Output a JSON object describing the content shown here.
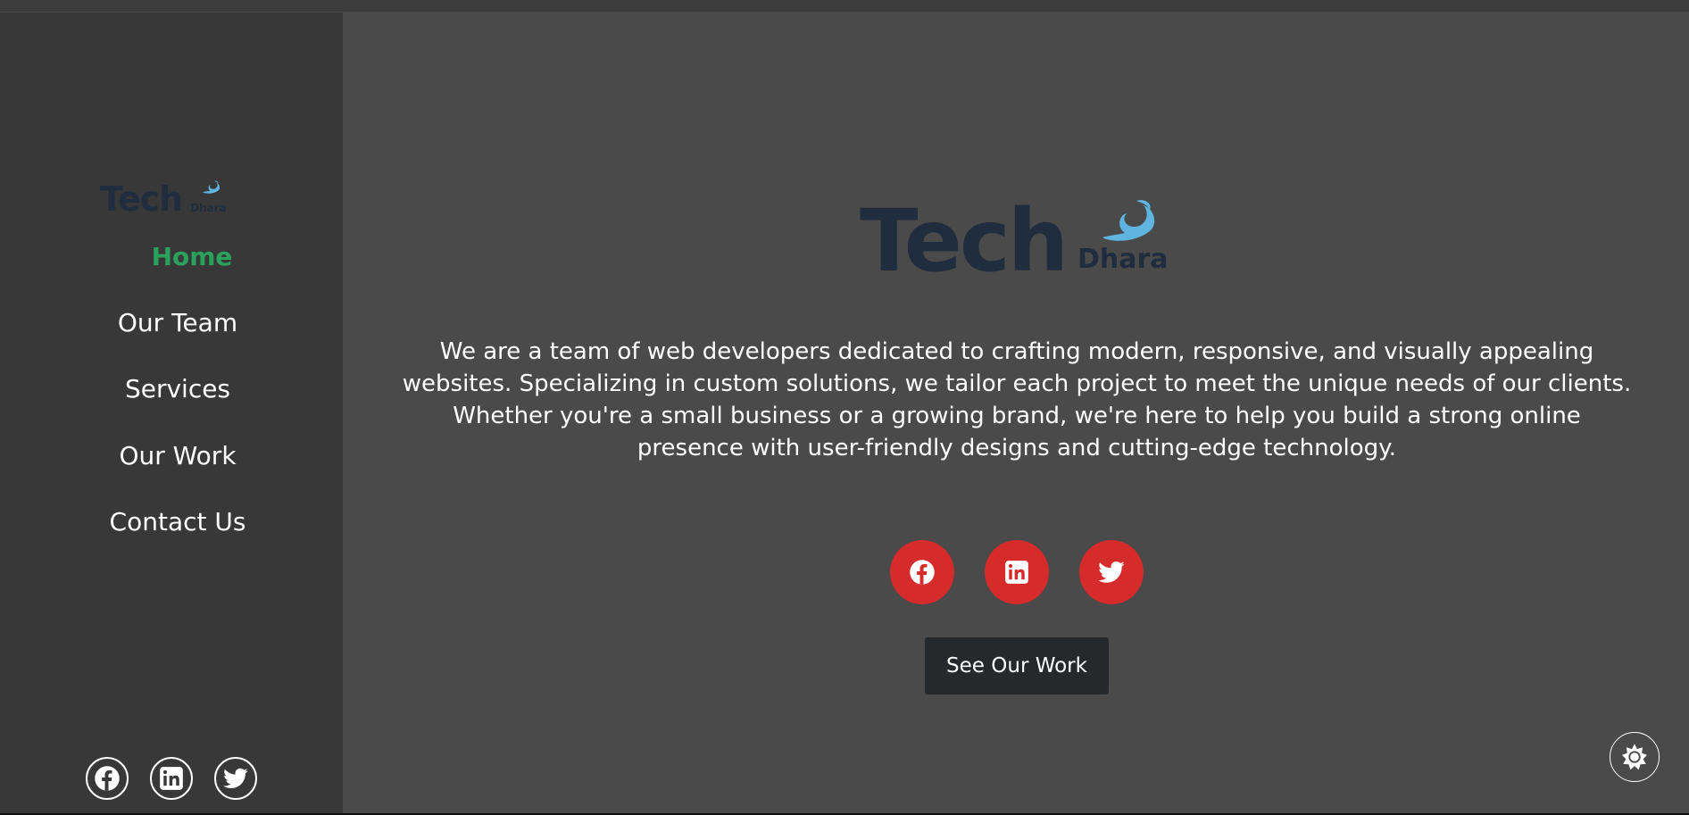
{
  "brand": {
    "word": "Tech",
    "sub": "Dhara"
  },
  "nav": {
    "items": [
      {
        "label": "Home",
        "active": true
      },
      {
        "label": "Our Team",
        "active": false
      },
      {
        "label": "Services",
        "active": false
      },
      {
        "label": "Our Work",
        "active": false
      },
      {
        "label": "Contact Us",
        "active": false
      }
    ]
  },
  "hero": {
    "description": "We are a team of web developers dedicated to crafting modern, responsive, and visually appealing websites. Specializing in custom solutions, we tailor each project to meet the unique needs of our clients. Whether you're a small business or a growing brand, we're here to help you build a strong online presence with user-friendly designs and cutting-edge technology.",
    "cta_label": "See Our Work"
  },
  "social": [
    "facebook-icon",
    "linkedin-icon",
    "twitter-icon"
  ],
  "colors": {
    "page_bg": "#4a4a4a",
    "sidebar_bg": "#383838",
    "active_nav": "#2aa15d",
    "logo_text": "#1f2d3f",
    "logo_wave": "#5fb4e0",
    "social_red": "#d52b2b",
    "cta_bg": "#25292c"
  }
}
